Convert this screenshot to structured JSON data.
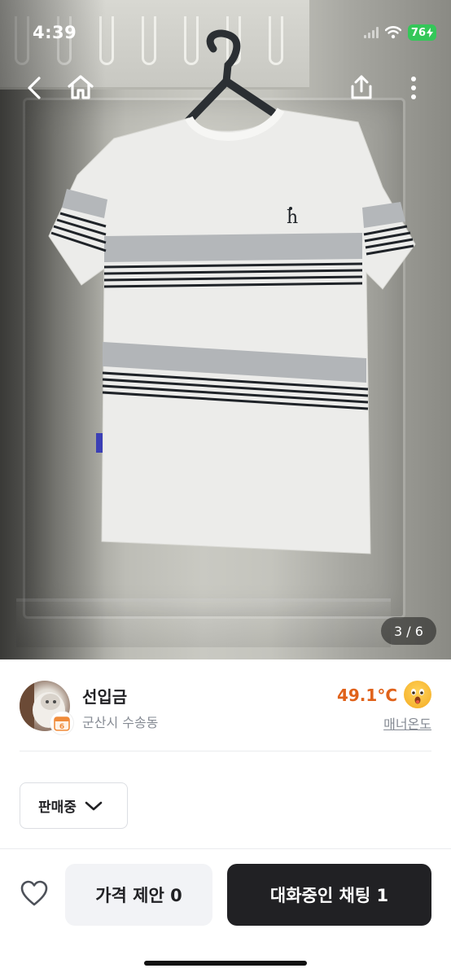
{
  "status_bar": {
    "time": "4:39",
    "battery": "76"
  },
  "photo": {
    "counter": "3 / 6"
  },
  "nav": {
    "back_icon": "chevron-left-icon",
    "home_icon": "home-icon",
    "share_icon": "share-icon",
    "more_icon": "more-vertical-icon"
  },
  "seller": {
    "name": "선입금",
    "location": "군산시 수송동",
    "temperature": "49.1°C",
    "manner_label": "매너온도",
    "badge_text": "6"
  },
  "sale_status": {
    "selected": "판매중"
  },
  "bottom_bar": {
    "offer_label": "가격 제안 0",
    "chat_label": "대화중인 채팅 1"
  },
  "colors": {
    "temperature": "#e0621a",
    "chat_button": "#212124",
    "offer_button": "#f2f3f6",
    "battery": "#34c759"
  }
}
